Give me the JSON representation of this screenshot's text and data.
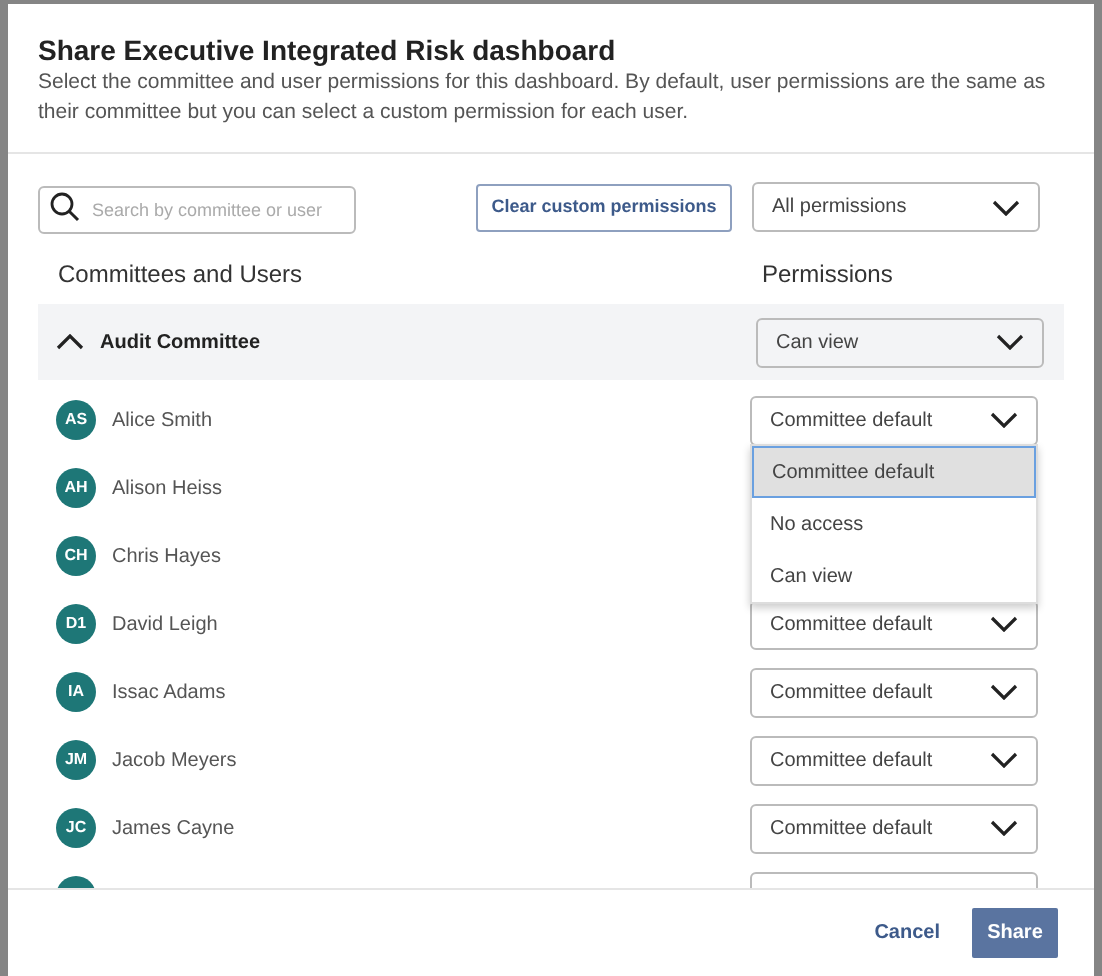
{
  "dialog": {
    "title": "Share Executive Integrated Risk dashboard",
    "description": "Select the committee and user permissions for this dashboard. By default, user permissions are the same as their committee but you can select a custom permission for each user."
  },
  "toolbar": {
    "search": {
      "placeholder": "Search by committee or user"
    },
    "clear_button": "Clear custom permissions",
    "filter": {
      "value": "All permissions"
    }
  },
  "columns": [
    "Committees and Users",
    "Permissions"
  ],
  "committee": {
    "name": "Audit Committee",
    "expanded": true,
    "permission": "Can view"
  },
  "users": [
    {
      "kind": "user",
      "initials": "AS",
      "name": "Alice Smith",
      "permission": "Committee default",
      "open": true
    },
    {
      "kind": "user",
      "initials": "AH",
      "name": "Alison Heiss"
    },
    {
      "kind": "user",
      "initials": "CH",
      "name": "Chris Hayes"
    },
    {
      "kind": "user",
      "initials": "D1",
      "name": "David Leigh",
      "permission": "Committee default"
    },
    {
      "kind": "user",
      "initials": "IA",
      "name": "Issac Adams",
      "permission": "Committee default"
    },
    {
      "kind": "user",
      "initials": "JM",
      "name": "Jacob Meyers",
      "permission": "Committee default"
    },
    {
      "kind": "user",
      "initials": "JC",
      "name": "James Cayne",
      "permission": "Committee default"
    },
    {
      "kind": "clipped"
    }
  ],
  "dropdown_menu": [
    {
      "label": "Committee default",
      "selected": true
    },
    {
      "label": "No access",
      "selected": false
    },
    {
      "label": "Can view",
      "selected": false
    }
  ],
  "footer": {
    "cancel": "Cancel",
    "share": "Share"
  }
}
